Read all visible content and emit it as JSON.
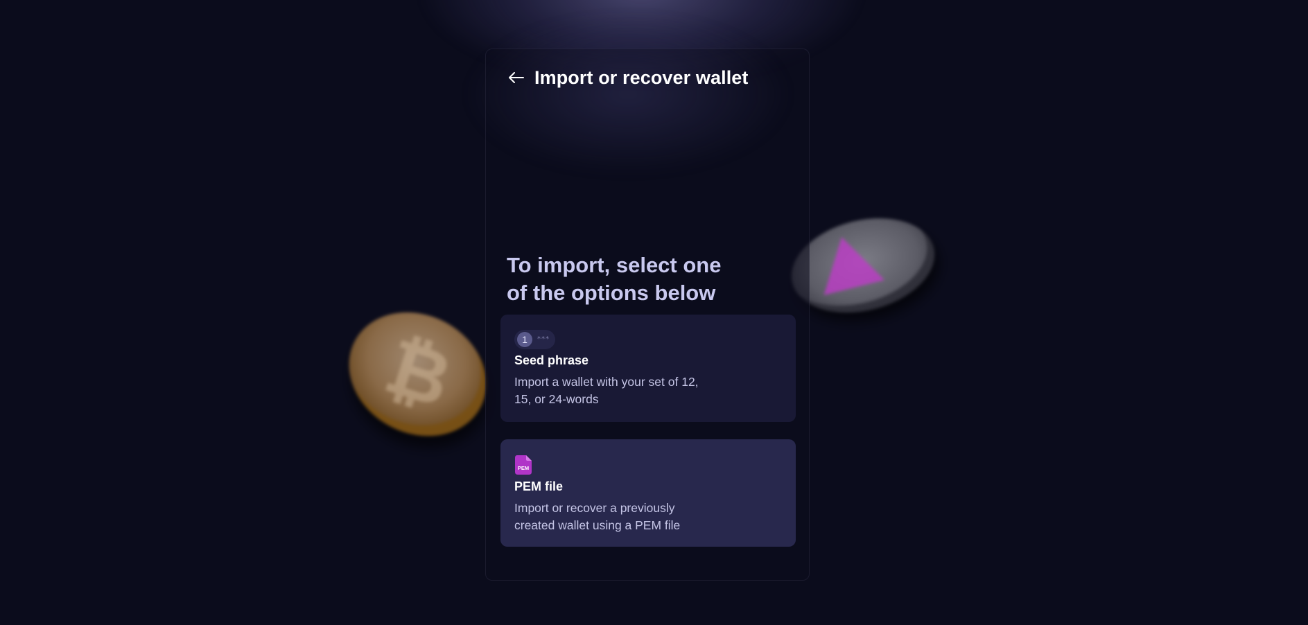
{
  "header": {
    "title": "Import or recover wallet",
    "back_icon": "arrow-left-icon"
  },
  "intro": {
    "text": "To import, select one of the options below"
  },
  "options": [
    {
      "icon": "seed-phrase-icon",
      "badge_number": "1",
      "badge_dots": "***",
      "title": "Seed phrase",
      "description": "Import a wallet with your set of 12, 15, or 24-words"
    },
    {
      "icon": "pem-file-icon",
      "icon_label": "PEM",
      "title": "PEM file",
      "description": "Import or recover a previously created wallet using a PEM file"
    }
  ],
  "decorations": {
    "left_coin": "bitcoin-coin",
    "right_coin": "ethereum-coin"
  },
  "colors": {
    "background": "#0b0c1c",
    "seed_card": "#191935",
    "pem_card": "#28284d",
    "intro_text": "#c9c9ef",
    "pem_icon": "#b035c8"
  }
}
